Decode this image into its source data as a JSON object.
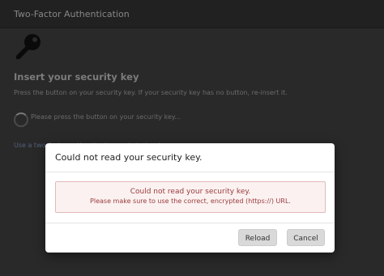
{
  "page": {
    "title": "Two-Factor Authentication",
    "heading": "Insert your security key",
    "instruction": "Press the button on your security key. If your security key has no button, re-insert it.",
    "status": "Please press the button on your security key...",
    "alt_link": "Use a two-factor authentication code instead"
  },
  "dialog": {
    "title": "Could not read your security key.",
    "alert_title": "Could not read your security key.",
    "alert_text": "Please make sure to use the correct, encrypted (https://) URL.",
    "reload_label": "Reload",
    "cancel_label": "Cancel"
  },
  "colors": {
    "alert_text": "#9b3b3b",
    "alert_background": "#fbf1f1",
    "button_background": "#d9d9d9"
  },
  "icons": {
    "key": "key-icon",
    "spinner": "loading-spinner-icon"
  }
}
